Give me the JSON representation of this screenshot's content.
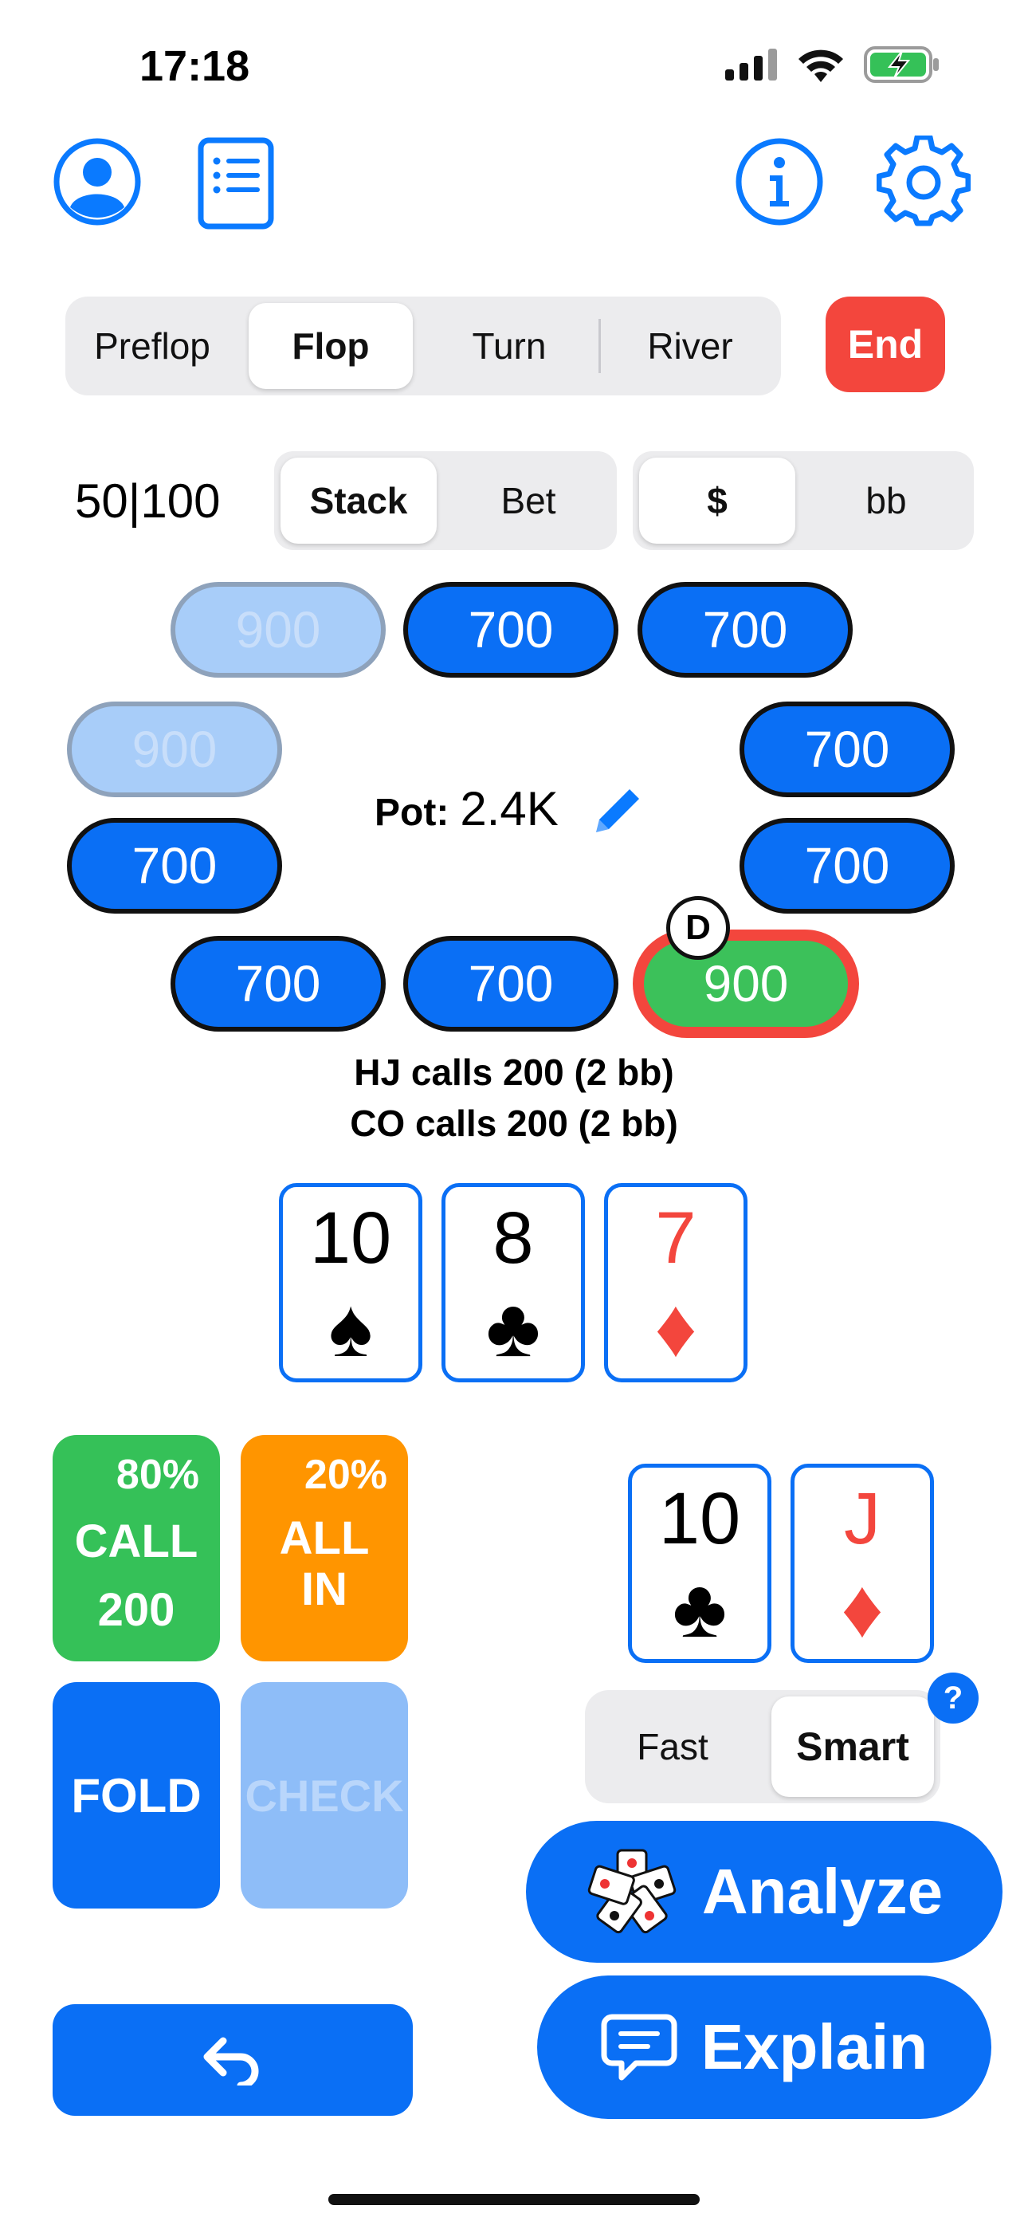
{
  "status": {
    "time": "17:18"
  },
  "streets": {
    "items": [
      "Preflop",
      "Flop",
      "Turn",
      "River"
    ],
    "selected": "Flop",
    "end_label": "End"
  },
  "blinds": "50|100",
  "display_mode": {
    "items": [
      "Stack",
      "Bet"
    ],
    "selected": "Stack"
  },
  "unit_mode": {
    "items": [
      "$",
      "bb"
    ],
    "selected": "$"
  },
  "seats": [
    {
      "stack": "900",
      "state": "inactive"
    },
    {
      "stack": "700",
      "state": "active"
    },
    {
      "stack": "700",
      "state": "active"
    },
    {
      "stack": "900",
      "state": "inactive"
    },
    {
      "stack": "700",
      "state": "active"
    },
    {
      "stack": "700",
      "state": "active"
    },
    {
      "stack": "700",
      "state": "active"
    },
    {
      "stack": "700",
      "state": "active"
    },
    {
      "stack": "700",
      "state": "active"
    },
    {
      "stack": "900",
      "state": "hero"
    }
  ],
  "dealer_label": "D",
  "pot": {
    "label": "Pot:",
    "value": "2.4K"
  },
  "action_log": [
    "HJ calls 200 (2 bb)",
    "CO calls 200 (2 bb)"
  ],
  "board": [
    {
      "rank": "10",
      "suit": "♠",
      "color": "#000000"
    },
    {
      "rank": "8",
      "suit": "♣",
      "color": "#000000"
    },
    {
      "rank": "7",
      "suit": "♦",
      "color": "#f3463d"
    }
  ],
  "hand": [
    {
      "rank": "10",
      "suit": "♣",
      "color": "#000000"
    },
    {
      "rank": "J",
      "suit": "♦",
      "color": "#f3463d"
    }
  ],
  "actions": {
    "call": {
      "pct": "80%",
      "line1": "CALL",
      "line2": "200",
      "color": "#35c158"
    },
    "allin": {
      "pct": "20%",
      "line1": "ALL",
      "line2": "IN",
      "color": "#ff9500"
    },
    "fold": {
      "label": "FOLD",
      "color": "#0a6ff5"
    },
    "check": {
      "label": "CHECK",
      "color": "#8ebdf8",
      "enabled": false
    }
  },
  "analysis_mode": {
    "items": [
      "Fast",
      "Smart"
    ],
    "selected": "Smart",
    "help": "?"
  },
  "buttons": {
    "analyze": "Analyze",
    "explain": "Explain"
  },
  "colors": {
    "accent": "#0a6ff5",
    "end": "#f3463d",
    "hero_border": "#f3463d"
  }
}
